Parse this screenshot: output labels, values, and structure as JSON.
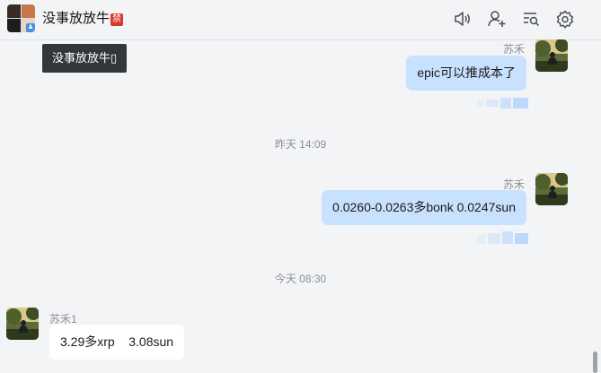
{
  "header": {
    "title": "没事放放牛",
    "badge": "禁",
    "group_avatar_badge": "♟",
    "icons": [
      "speaker-icon",
      "add-member-icon",
      "chat-search-icon",
      "settings-icon"
    ]
  },
  "tooltip": {
    "text": "没事放放牛▯"
  },
  "timestamps": {
    "yesterday": "昨天 14:09",
    "today": "今天 08:30"
  },
  "messages": [
    {
      "sender": "苏禾",
      "text": "epic可以推成本了",
      "side": "right"
    },
    {
      "sender": "苏禾",
      "text": "0.0260-0.0263多bonk 0.0247sun",
      "side": "right"
    },
    {
      "sender": "苏禾1",
      "text": "3.29多xrp    3.08sun",
      "side": "left"
    }
  ],
  "colors": {
    "my_bubble": "#c8e1ff",
    "their_bubble": "#ffffff",
    "background": "#f3f4f6",
    "tooltip_bg": "#33363b",
    "read_mark": "#bcd8fa"
  }
}
